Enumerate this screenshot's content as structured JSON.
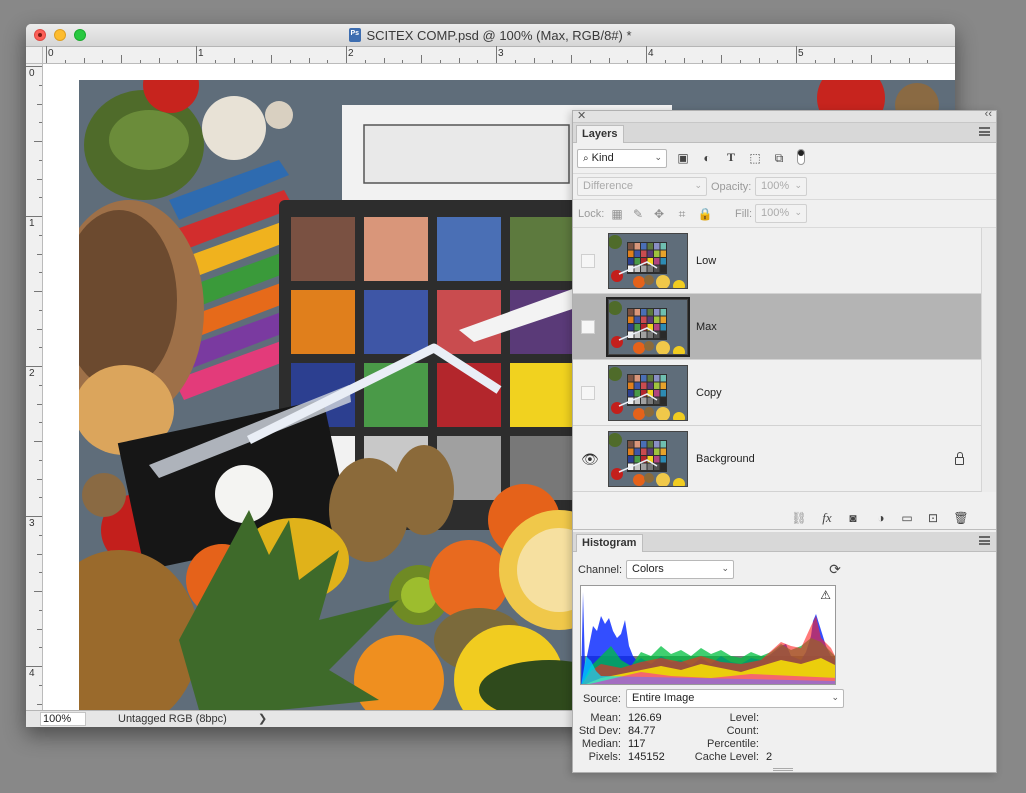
{
  "window": {
    "title": "SCITEX COMP.psd @ 100% (Max, RGB/8#) *",
    "zoom": "100%",
    "doc_info": "Untagged RGB (8bpc)",
    "status_arrow": "❯"
  },
  "rulers": {
    "h_labels": [
      "0",
      "1",
      "2",
      "3",
      "4",
      "5"
    ],
    "v_labels": [
      "0",
      "1",
      "2",
      "3",
      "4"
    ]
  },
  "layers_panel": {
    "tab": "Layers",
    "filter_kind": "Kind",
    "blend_mode": "Difference",
    "opacity_label": "Opacity:",
    "opacity_value": "100%",
    "lock_label": "Lock:",
    "fill_label": "Fill:",
    "fill_value": "100%",
    "layers": [
      {
        "name": "Low",
        "visible": false,
        "selected": false,
        "locked": false
      },
      {
        "name": "Max",
        "visible": false,
        "selected": true,
        "locked": false
      },
      {
        "name": "Copy",
        "visible": false,
        "selected": false,
        "locked": false
      },
      {
        "name": "Background",
        "visible": true,
        "selected": false,
        "locked": true
      }
    ],
    "footer_fx": "fx"
  },
  "histogram_panel": {
    "tab": "Histogram",
    "channel_label": "Channel:",
    "channel_value": "Colors",
    "source_label": "Source:",
    "source_value": "Entire Image",
    "warning_icon": "⚠",
    "stats_left": [
      {
        "label": "Mean:",
        "value": "126.69"
      },
      {
        "label": "Std Dev:",
        "value": "84.77"
      },
      {
        "label": "Median:",
        "value": "117"
      },
      {
        "label": "Pixels:",
        "value": "145152"
      }
    ],
    "stats_right": [
      {
        "label": "Level:",
        "value": ""
      },
      {
        "label": "Count:",
        "value": ""
      },
      {
        "label": "Percentile:",
        "value": ""
      },
      {
        "label": "Cache Level:",
        "value": "2"
      }
    ]
  },
  "colors": {
    "chart_swatches": [
      "#7a5142",
      "#d9967a",
      "#4a6fb5",
      "#5d7a3e",
      "#8a8fc4",
      "#6fbfb0",
      "#e07f1c",
      "#3e56a6",
      "#c94c4f",
      "#5a3a78",
      "#9fc33e",
      "#e8a32a",
      "#2c3f90",
      "#4a9a48",
      "#b3262c",
      "#f1d21f",
      "#b1457f",
      "#2d8bb3",
      "#f2f2f2",
      "#c8c8c8",
      "#a0a0a0",
      "#787878",
      "#505050",
      "#2a2a2a"
    ],
    "selection": "#b4b4b4",
    "panel_bg": "#f0f0f0"
  }
}
